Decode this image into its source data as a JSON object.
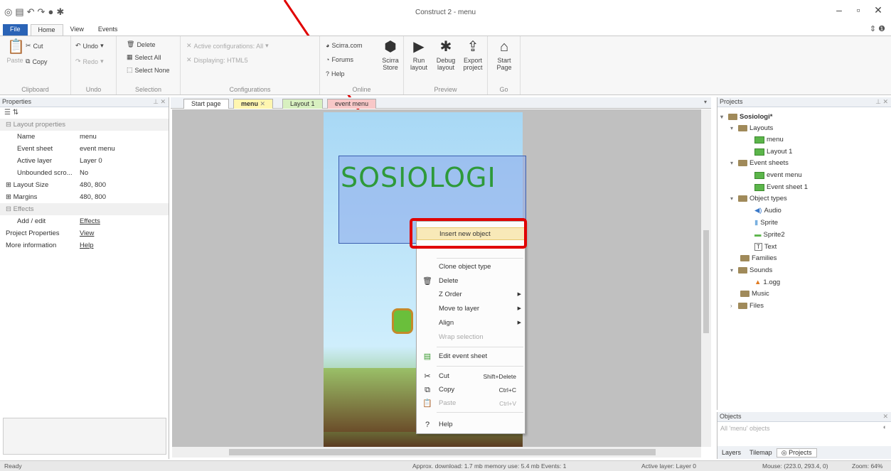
{
  "window": {
    "title": "Construct 2 - menu"
  },
  "ribbon_tabs": [
    "File",
    "Home",
    "View",
    "Events"
  ],
  "ribbon": {
    "clipboard": {
      "paste": "Paste",
      "cut": "Cut",
      "copy": "Copy",
      "title": "Clipboard"
    },
    "undo": {
      "undo": "Undo",
      "redo": "Redo",
      "title": "Undo"
    },
    "selection": {
      "delete": "Delete",
      "select_all": "Select All",
      "select_none": "Select None",
      "title": "Selection"
    },
    "configurations": {
      "active": "Active configurations: All",
      "displaying": "Displaying: HTML5",
      "title": "Configurations"
    },
    "online": {
      "scirra": "Scirra.com",
      "forums": "Forums",
      "help": "Help",
      "store": "Scirra Store",
      "title": "Online"
    },
    "preview": {
      "run": "Run layout",
      "debug": "Debug layout",
      "export": "Export project",
      "title": "Preview"
    },
    "go": {
      "start": "Start Page",
      "title": "Go"
    }
  },
  "properties": {
    "title": "Properties",
    "category_layout": "Layout properties",
    "rows": [
      {
        "k": "Name",
        "v": "menu"
      },
      {
        "k": "Event sheet",
        "v": "event menu"
      },
      {
        "k": "Active layer",
        "v": "Layer 0"
      },
      {
        "k": "Unbounded scro...",
        "v": "No"
      }
    ],
    "layout_size": {
      "k": "Layout Size",
      "v": "480, 800"
    },
    "margins": {
      "k": "Margins",
      "v": "480, 800"
    },
    "category_effects": "Effects",
    "add_edit": {
      "k": "Add / edit",
      "v": "Effects"
    },
    "project_properties": {
      "k": "Project Properties",
      "v": "View"
    },
    "more_information": {
      "k": "More information",
      "v": "Help"
    }
  },
  "doc_tabs": [
    "Start page",
    "menu",
    "Layout 1",
    "event menu"
  ],
  "canvas": {
    "title_text": "SOSIOLOGI"
  },
  "context_menu": {
    "items": [
      {
        "label": "Insert new object"
      },
      {
        "label": "Clone object type"
      },
      {
        "label": "Delete"
      },
      {
        "label": "Z Order"
      },
      {
        "label": "Move to layer"
      },
      {
        "label": "Align"
      },
      {
        "label": "Wrap selection"
      },
      {
        "label": "Edit event sheet"
      },
      {
        "label": "Cut",
        "shortcut": "Shift+Delete"
      },
      {
        "label": "Copy",
        "shortcut": "Ctrl+C"
      },
      {
        "label": "Paste",
        "shortcut": "Ctrl+V"
      },
      {
        "label": "Help"
      }
    ]
  },
  "projects": {
    "title": "Projects",
    "root": "Sosiologi*",
    "layouts": "Layouts",
    "layout_items": [
      "menu",
      "Layout 1"
    ],
    "event_sheets": "Event sheets",
    "event_items": [
      "event menu",
      "Event sheet 1"
    ],
    "object_types": "Object types",
    "object_items": [
      "Audio",
      "Sprite",
      "Sprite2",
      "Text"
    ],
    "families": "Families",
    "sounds": "Sounds",
    "sound_items": [
      "1.ogg"
    ],
    "music": "Music",
    "files": "Files"
  },
  "objects": {
    "title": "Objects",
    "filter": "All 'menu' objects"
  },
  "bottom_tabs": [
    "Layers",
    "Tilemap",
    "Projects"
  ],
  "status": {
    "ready": "Ready",
    "download": "Approx. download: 1.7 mb  memory use: 5.4 mb  Events: 1",
    "layer": "Active layer: Layer 0",
    "mouse": "Mouse: (223.0, 293.4, 0)",
    "zoom": "Zoom: 64%"
  },
  "colors": {
    "accent": "#2a63b6",
    "highlight": "#e00000",
    "sosiologi": "#2e9a3a"
  }
}
